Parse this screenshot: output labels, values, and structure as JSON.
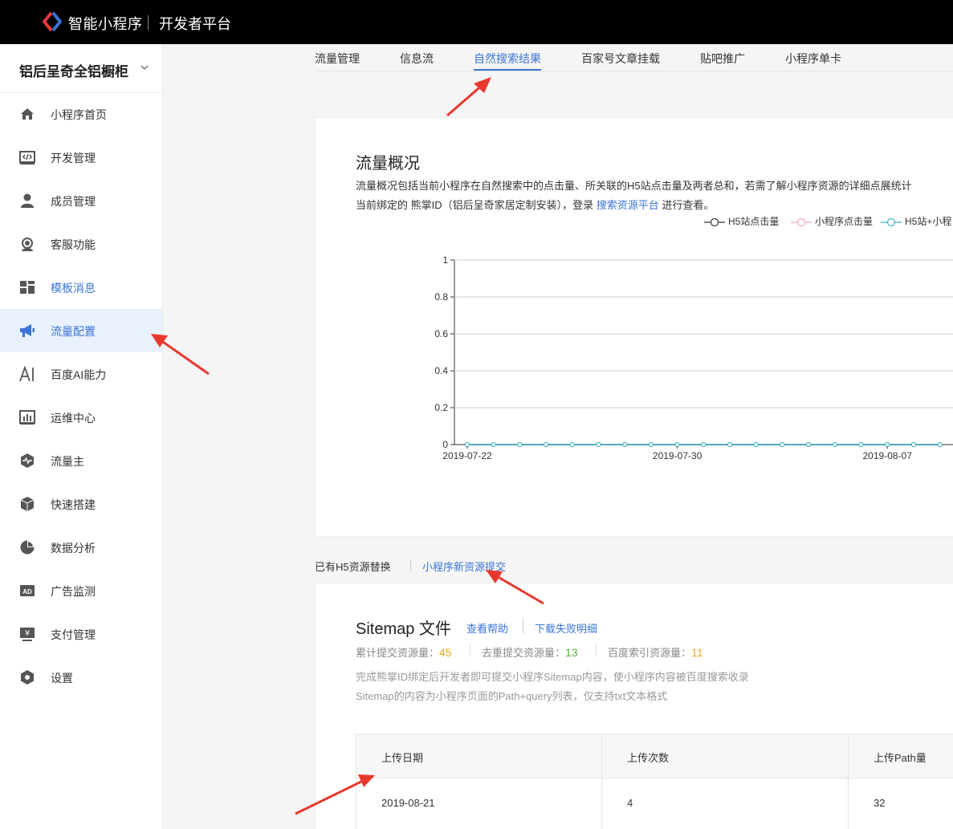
{
  "header": {
    "brand": "智能小程序",
    "subtitle": "开发者平台"
  },
  "sidebar": {
    "app_name": "铝后呈奇全铝橱柜",
    "items": [
      {
        "label": "小程序首页",
        "icon": "home-icon"
      },
      {
        "label": "开发管理",
        "icon": "code-icon"
      },
      {
        "label": "成员管理",
        "icon": "user-icon"
      },
      {
        "label": "客服功能",
        "icon": "headset-icon"
      },
      {
        "label": "模板消息",
        "icon": "template-icon"
      },
      {
        "label": "流量配置",
        "icon": "megaphone-icon"
      },
      {
        "label": "百度AI能力",
        "icon": "ai-icon"
      },
      {
        "label": "运维中心",
        "icon": "bar-chart-icon"
      },
      {
        "label": "流量主",
        "icon": "pulse-icon"
      },
      {
        "label": "快速搭建",
        "icon": "cube-icon"
      },
      {
        "label": "数据分析",
        "icon": "pie-icon"
      },
      {
        "label": "广告监测",
        "icon": "ad-icon"
      },
      {
        "label": "支付管理",
        "icon": "payment-icon"
      },
      {
        "label": "设置",
        "icon": "settings-icon"
      }
    ]
  },
  "tabs": [
    "流量管理",
    "信息流",
    "自然搜索结果",
    "百家号文章挂载",
    "贴吧推广",
    "小程序单卡"
  ],
  "overview": {
    "title": "流量概况",
    "desc1": "流量概况包括当前小程序在自然搜索中的点击量、所关联的H5站点击量及两者总和，若需了解小程序资源的详细点展统计",
    "desc2_pre": "当前绑定的 熊掌ID（铝后呈奇家居定制安装），登录 ",
    "desc2_link": "搜索资源平台",
    "desc2_post": " 进行查看。"
  },
  "chart_data": {
    "type": "line",
    "legend": [
      "H5站点击量",
      "小程序点击量",
      "H5站+小程"
    ],
    "colors": {
      "h5": "#333333",
      "mini": "#f4a7b6",
      "total": "#3ab8c8"
    },
    "y_ticks": [
      "0",
      "0.2",
      "0.4",
      "0.6",
      "0.8",
      "1"
    ],
    "ylim": [
      0,
      1
    ],
    "x_tick_labels": [
      "2019-07-22",
      "2019-07-30",
      "2019-08-07"
    ],
    "x_start": "2019-07-22",
    "x_end": "2019-08-09",
    "series": [
      {
        "name": "H5站点击量",
        "value": 0
      },
      {
        "name": "小程序点击量",
        "value": 0
      },
      {
        "name": "H5站+小程",
        "value": 0
      }
    ],
    "grid": true
  },
  "resources": {
    "tab1": "已有H5资源替换",
    "tab2": "小程序新资源提交"
  },
  "sitemap": {
    "title": "Sitemap 文件",
    "help": "查看帮助",
    "download": "下载失败明细",
    "stat1_label": "累计提交资源量：",
    "stat1_value": "45",
    "stat2_label": "去重提交资源量：",
    "stat2_value": "13",
    "stat3_label": "百度索引资源量：",
    "stat3_value": "11",
    "note1": "完成熊掌ID绑定后开发者即可提交小程序Sitemap内容，使小程序内容被百度搜索收录",
    "note2": "Sitemap的内容为小程序页面的Path+query列表，仅支持txt文本格式"
  },
  "table": {
    "headers": [
      "上传日期",
      "上传次数",
      "上传Path量"
    ],
    "rows": [
      [
        "2019-08-21",
        "4",
        "32"
      ]
    ]
  }
}
